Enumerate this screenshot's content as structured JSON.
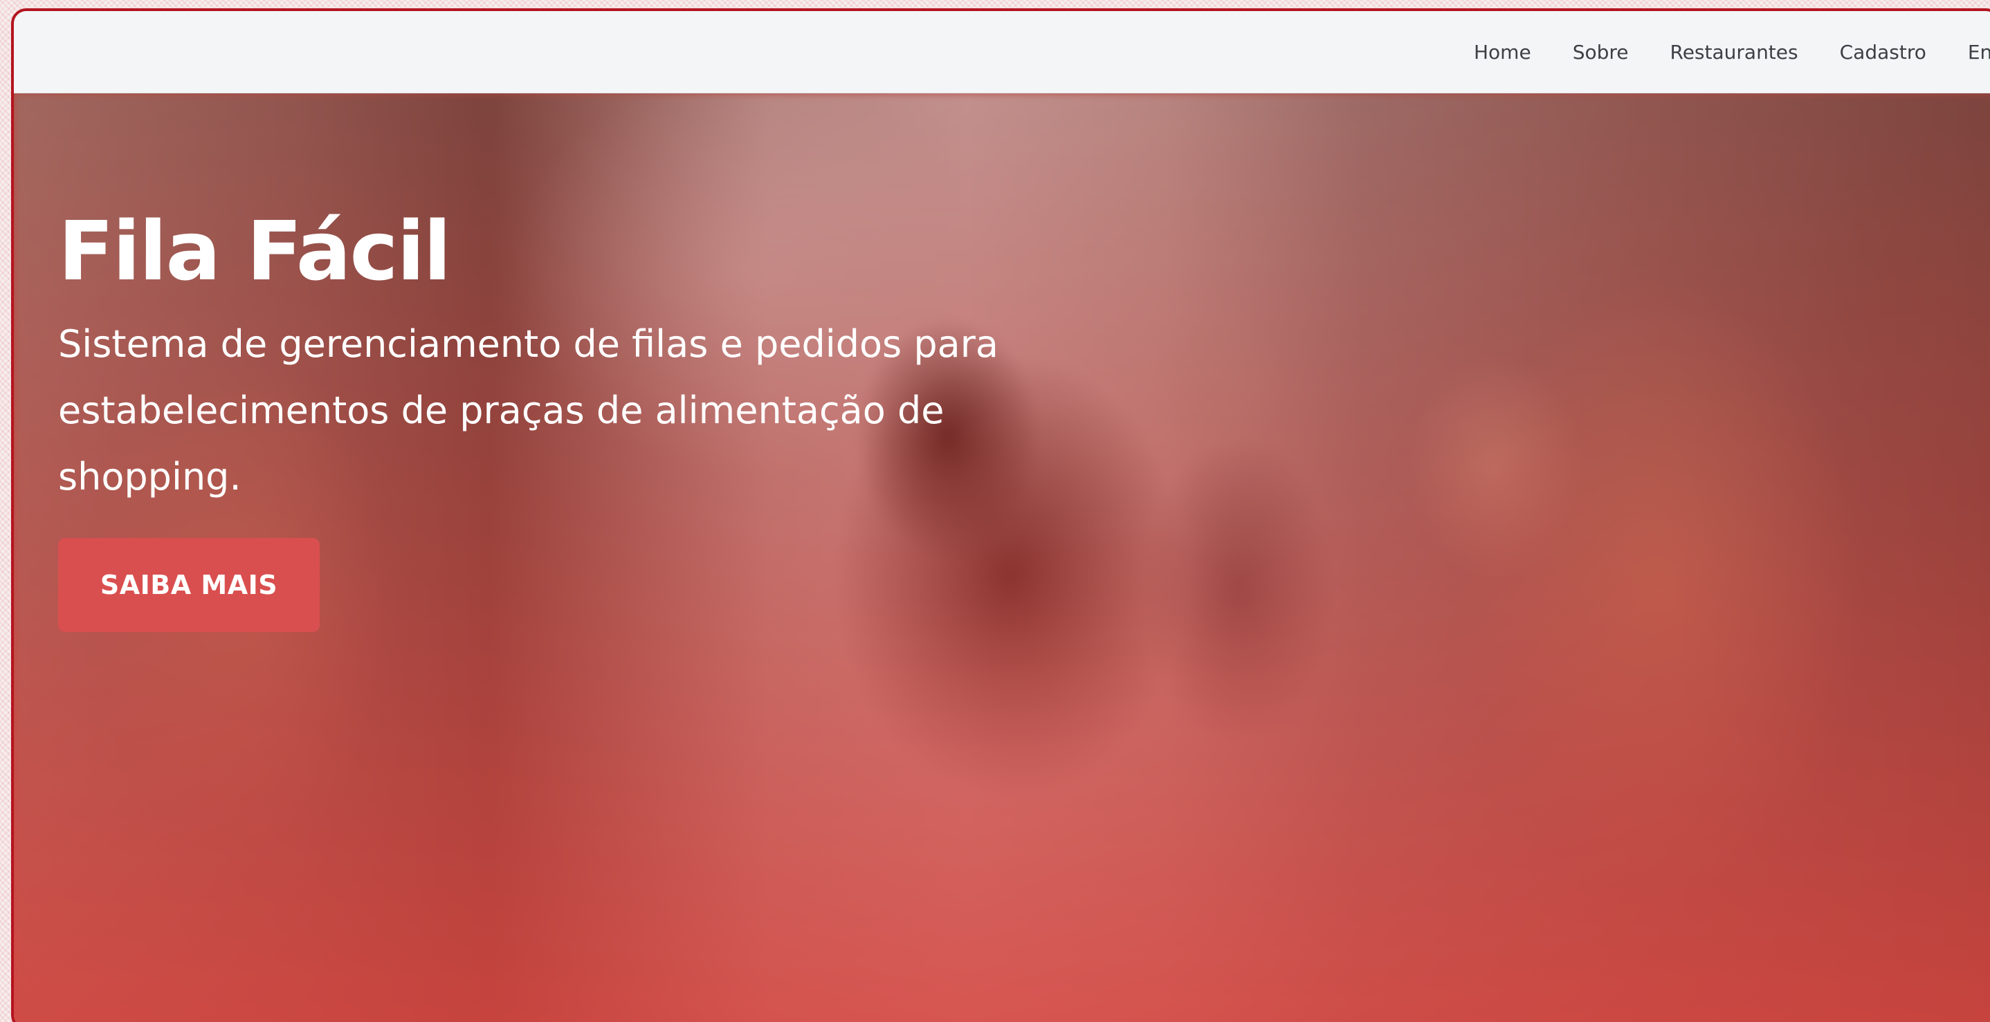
{
  "nav": {
    "items": [
      {
        "label": "Home"
      },
      {
        "label": "Sobre"
      },
      {
        "label": "Restaurantes"
      },
      {
        "label": "Cadastro"
      },
      {
        "label": "En"
      }
    ]
  },
  "hero": {
    "title": "Fila Fácil",
    "subtitle": "Sistema de gerenciamento de filas e pedidos para estabelecimentos de praças de alimentação de shopping.",
    "button_label": "SAIBA MAIS"
  },
  "colors": {
    "accent": "#d94f4f",
    "navbar_bg": "#f4f5f7",
    "frame_border": "#b3141f"
  }
}
